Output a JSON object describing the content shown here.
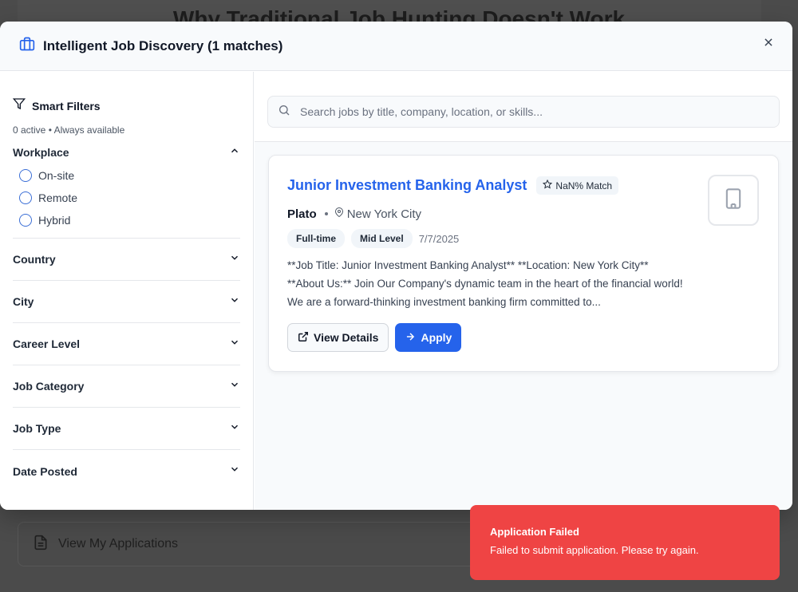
{
  "background": {
    "heading": "Why Traditional Job Hunting Doesn't Work",
    "applications_label": "View My Applications"
  },
  "modal": {
    "title": "Intelligent Job Discovery (1 matches)"
  },
  "sidebar": {
    "title": "Smart Filters",
    "subtitle": "0 active • Always available",
    "workplace": {
      "label": "Workplace",
      "options": [
        "On-site",
        "Remote",
        "Hybrid"
      ]
    },
    "sections": [
      "Country",
      "City",
      "Career Level",
      "Job Category",
      "Job Type",
      "Date Posted"
    ]
  },
  "search": {
    "placeholder": "Search jobs by title, company, location, or skills..."
  },
  "job": {
    "title": "Junior Investment Banking Analyst",
    "match": "NaN% Match",
    "company": "Plato",
    "location": "New York City",
    "tags": [
      "Full-time",
      "Mid Level"
    ],
    "date": "7/7/2025",
    "description": "**Job Title: Junior Investment Banking Analyst** **Location: New York City** **About Us:** Join Our Company's dynamic team in the heart of the financial world! We are a forward-thinking investment banking firm committed to...",
    "view_details": "View Details",
    "apply": "Apply"
  },
  "toast": {
    "title": "Application Failed",
    "message": "Failed to submit application. Please try again."
  },
  "colors": {
    "accent": "#2563eb",
    "error": "#ef4444"
  }
}
